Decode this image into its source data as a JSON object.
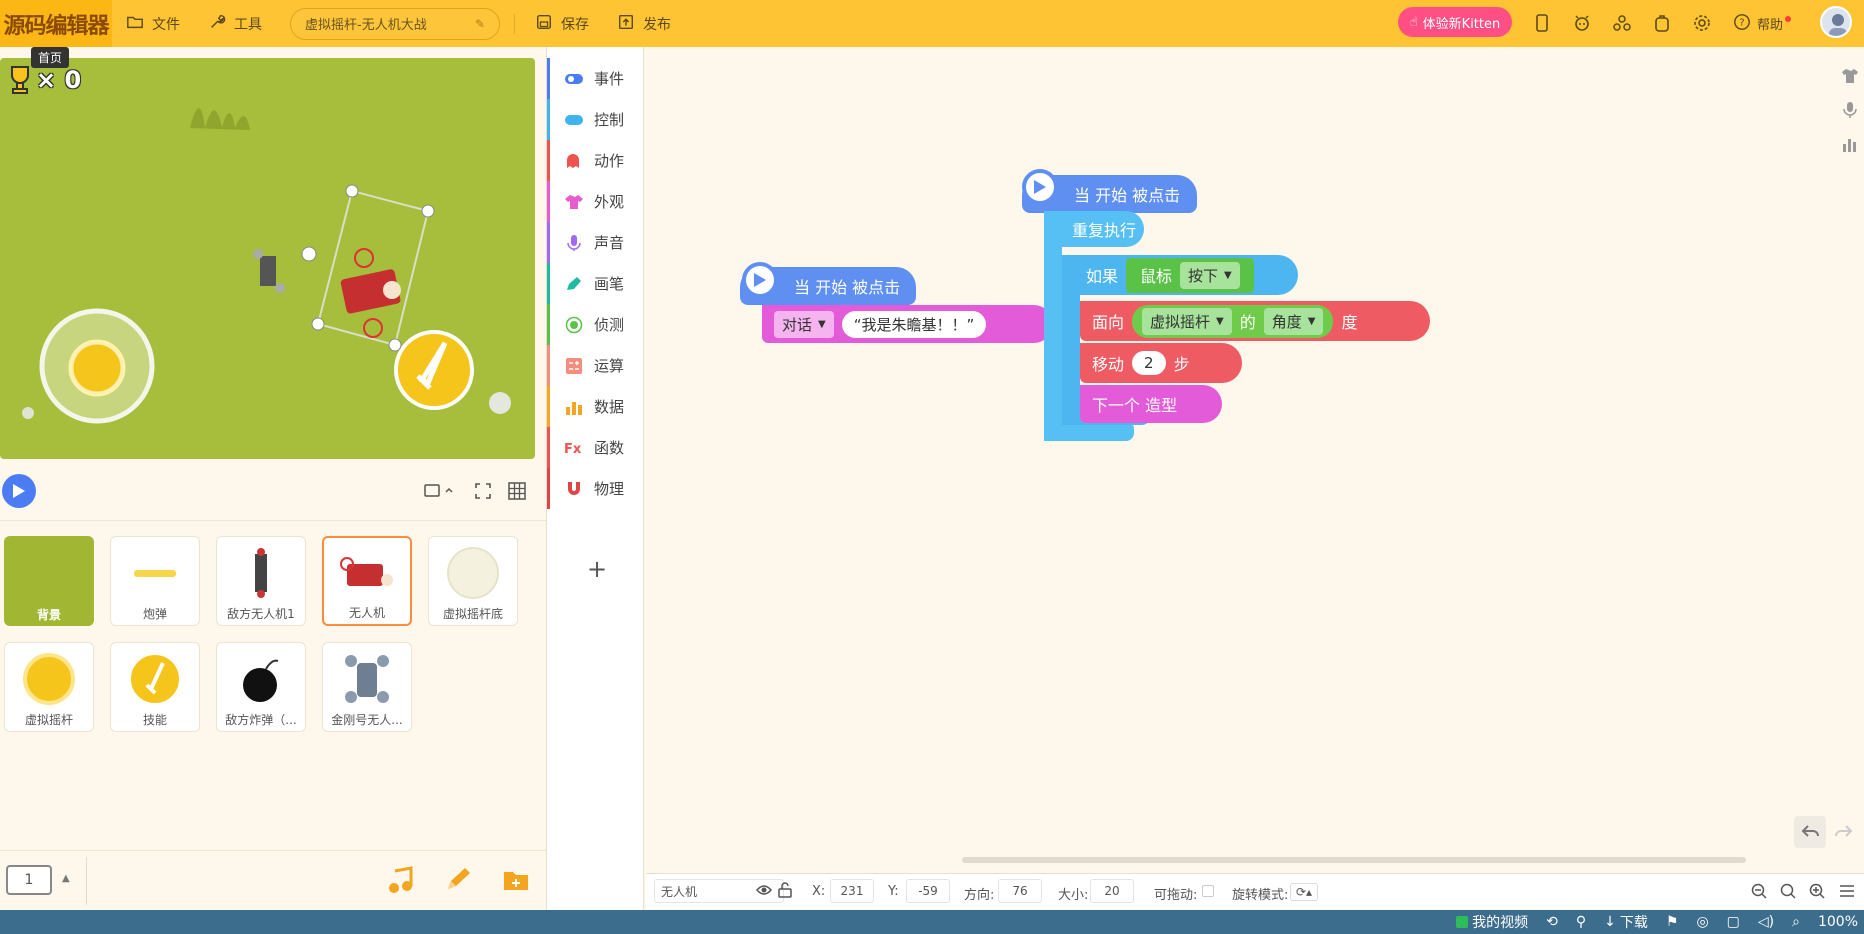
{
  "topbar": {
    "logo": "源码编辑器",
    "file": "文件",
    "tools": "工具",
    "project_name": "虚拟摇杆-无人机大战",
    "save": "保存",
    "publish": "发布",
    "kitten": "体验新Kitten",
    "help": "帮助"
  },
  "tooltip": "首页",
  "stage": {
    "score": "× 0"
  },
  "categories": [
    {
      "label": "事件",
      "color": "#4c7cf3"
    },
    {
      "label": "控制",
      "color": "#3fb4ef"
    },
    {
      "label": "动作",
      "color": "#ef5350"
    },
    {
      "label": "外观",
      "color": "#e95bd1"
    },
    {
      "label": "声音",
      "color": "#a06bf1"
    },
    {
      "label": "画笔",
      "color": "#1fbba0"
    },
    {
      "label": "侦测",
      "color": "#5bc248"
    },
    {
      "label": "运算",
      "color": "#f38d7e"
    },
    {
      "label": "数据",
      "color": "#f5a623"
    },
    {
      "label": "函数",
      "color": "#ef5350"
    },
    {
      "label": "物理",
      "color": "#e04545"
    }
  ],
  "sprites": [
    {
      "label": "背景"
    },
    {
      "label": "炮弹"
    },
    {
      "label": "敌方无人机1"
    },
    {
      "label": "无人机"
    },
    {
      "label": "虚拟摇杆底"
    },
    {
      "label": "虚拟摇杆"
    },
    {
      "label": "技能"
    },
    {
      "label": "敌方炸弹（..."
    },
    {
      "label": "金刚号无人..."
    }
  ],
  "page_num": "1",
  "scripts": {
    "s1": {
      "hat": "当 开始 被点击",
      "say": "对话",
      "say_text": "“我是朱瞻基！！”"
    },
    "s2": {
      "hat": "当 开始 被点击",
      "repeat": "重复执行",
      "if": "如果",
      "mouse": "鼠标",
      "pressed": "按下",
      "face": "面向",
      "joystick": "虚拟摇杆",
      "of": "的",
      "angle": "角度",
      "degree": "度",
      "move": "移动",
      "steps_val": "2",
      "steps": "步",
      "next": "下一个 造型"
    }
  },
  "props": {
    "name": "无人机",
    "x_label": "X:",
    "x": "231",
    "y_label": "Y:",
    "y": "-59",
    "dir_label": "方向:",
    "dir": "76",
    "size_label": "大小:",
    "size": "20",
    "drag_label": "可拖动:",
    "rot_label": "旋转模式:"
  },
  "status": {
    "video": "我的视频",
    "download": "下载",
    "zoom": "100%"
  }
}
